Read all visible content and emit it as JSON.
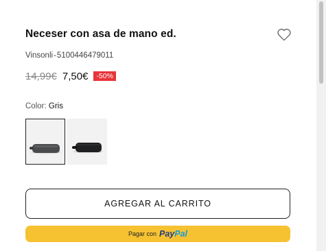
{
  "product": {
    "title": "Neceser con asa de mano ed.",
    "brand": "Vinsonli",
    "separator": "-",
    "sku": "5100446479011",
    "old_price": "14,99€",
    "new_price": "7,50€",
    "discount": "-50%",
    "color_label": "Color:",
    "color_value": "Gris"
  },
  "icons": {
    "wishlist": "heart-outline-icon"
  },
  "swatches": [
    {
      "name": "gris",
      "color": "#4a4b4d",
      "selected": true
    },
    {
      "name": "negro",
      "color": "#1f2022",
      "selected": false
    }
  ],
  "actions": {
    "add_to_cart": "AGREGAR AL CARRITO",
    "paypal_prefix": "Pagar con",
    "paypal_pay": "Pay",
    "paypal_pal": "Pal"
  },
  "colors": {
    "discount_bg": "#e8353a",
    "paypal_bg": "#f6c232",
    "paypal_dark": "#253b80",
    "paypal_light": "#179bd7"
  }
}
